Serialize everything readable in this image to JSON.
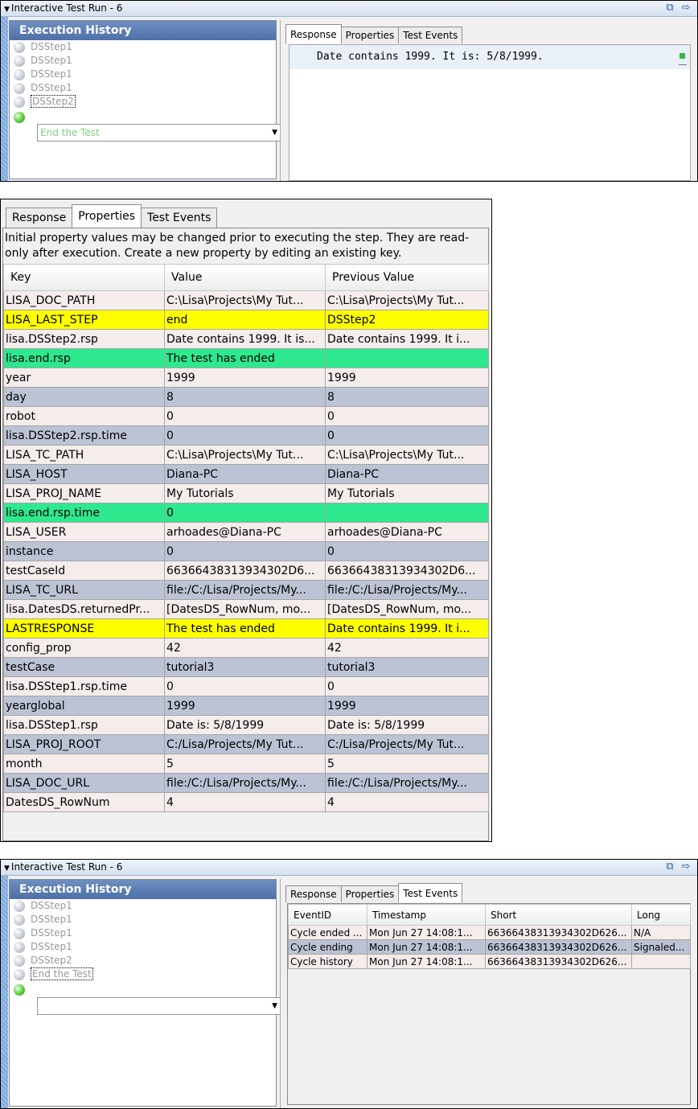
{
  "panel1": {
    "title": "Interactive Test Run - 6",
    "history_header": "Execution History",
    "steps": [
      "DSStep1",
      "DSStep1",
      "DSStep1",
      "DSStep1",
      "DSStep2"
    ],
    "combo_value": "End the Test",
    "tabs": [
      "Response",
      "Properties",
      "Test Events"
    ],
    "active_tab": "Response",
    "response_text": "Date contains 1999. It is: 5/8/1999."
  },
  "panel2": {
    "tabs": [
      "Response",
      "Properties",
      "Test Events"
    ],
    "active_tab": "Properties",
    "info": "Initial property values may be changed prior to executing the step. They are read-only after execution. Create a new property by editing an existing key.",
    "columns": [
      "Key",
      "Value",
      "Previous Value"
    ],
    "colors": {
      "pink": "#f5ecec",
      "blue": "#bbc3d4",
      "yellow": "#ffff00",
      "green": "#2ee88e"
    },
    "rows": [
      {
        "key": "LISA_DOC_PATH",
        "value": "C:\\Lisa\\Projects\\My Tut...",
        "prev": "C:\\Lisa\\Projects\\My Tut...",
        "hl": "pink"
      },
      {
        "key": "LISA_LAST_STEP",
        "value": "end",
        "prev": "DSStep2",
        "hl": "yellow"
      },
      {
        "key": "lisa.DSStep2.rsp",
        "value": "Date contains 1999. It is...",
        "prev": "Date contains 1999. It i...",
        "hl": "pink"
      },
      {
        "key": "lisa.end.rsp",
        "value": "The test has ended",
        "prev": "",
        "hl": "green"
      },
      {
        "key": "year",
        "value": "1999",
        "prev": "1999",
        "hl": "pink"
      },
      {
        "key": "day",
        "value": "8",
        "prev": "8",
        "hl": "blue"
      },
      {
        "key": "robot",
        "value": "0",
        "prev": "0",
        "hl": "pink"
      },
      {
        "key": "lisa.DSStep2.rsp.time",
        "value": "0",
        "prev": "0",
        "hl": "blue"
      },
      {
        "key": "LISA_TC_PATH",
        "value": "C:\\Lisa\\Projects\\My Tut...",
        "prev": "C:\\Lisa\\Projects\\My Tut...",
        "hl": "pink"
      },
      {
        "key": "LISA_HOST",
        "value": "Diana-PC",
        "prev": "Diana-PC",
        "hl": "blue"
      },
      {
        "key": "LISA_PROJ_NAME",
        "value": "My Tutorials",
        "prev": "My Tutorials",
        "hl": "pink"
      },
      {
        "key": "lisa.end.rsp.time",
        "value": "0",
        "prev": "",
        "hl": "green"
      },
      {
        "key": "LISA_USER",
        "value": "arhoades@Diana-PC",
        "prev": "arhoades@Diana-PC",
        "hl": "pink"
      },
      {
        "key": "instance",
        "value": "0",
        "prev": "0",
        "hl": "blue"
      },
      {
        "key": "testCaseId",
        "value": "66366438313934302D6...",
        "prev": "66366438313934302D6...",
        "hl": "pink"
      },
      {
        "key": "LISA_TC_URL",
        "value": "file:/C:/Lisa/Projects/My...",
        "prev": "file:/C:/Lisa/Projects/My...",
        "hl": "blue"
      },
      {
        "key": "lisa.DatesDS.returnedPr...",
        "value": "[DatesDS_RowNum, mo...",
        "prev": "[DatesDS_RowNum, mo...",
        "hl": "pink"
      },
      {
        "key": "LASTRESPONSE",
        "value": "The test has ended",
        "prev": "Date contains 1999. It i...",
        "hl": "yellow"
      },
      {
        "key": "config_prop",
        "value": "42",
        "prev": "42",
        "hl": "pink"
      },
      {
        "key": "testCase",
        "value": "tutorial3",
        "prev": "tutorial3",
        "hl": "blue"
      },
      {
        "key": "lisa.DSStep1.rsp.time",
        "value": "0",
        "prev": "0",
        "hl": "pink"
      },
      {
        "key": "yearglobal",
        "value": "1999",
        "prev": "1999",
        "hl": "blue"
      },
      {
        "key": "lisa.DSStep1.rsp",
        "value": "Date is: 5/8/1999",
        "prev": "Date is: 5/8/1999",
        "hl": "pink"
      },
      {
        "key": "LISA_PROJ_ROOT",
        "value": "C:/Lisa/Projects/My Tut...",
        "prev": "C:/Lisa/Projects/My Tut...",
        "hl": "blue"
      },
      {
        "key": "month",
        "value": "5",
        "prev": "5",
        "hl": "pink"
      },
      {
        "key": "LISA_DOC_URL",
        "value": "file:/C:/Lisa/Projects/My...",
        "prev": "file:/C:/Lisa/Projects/My...",
        "hl": "blue"
      },
      {
        "key": "DatesDS_RowNum",
        "value": "4",
        "prev": "4",
        "hl": "pink"
      }
    ]
  },
  "panel3": {
    "title": "Interactive Test Run - 6",
    "history_header": "Execution History",
    "steps": [
      "DSStep1",
      "DSStep1",
      "DSStep1",
      "DSStep1",
      "DSStep2",
      "End the Test"
    ],
    "combo_value": "",
    "tabs": [
      "Response",
      "Properties",
      "Test Events"
    ],
    "active_tab": "Test Events",
    "columns": [
      "EventID",
      "Timestamp",
      "Short",
      "Long"
    ],
    "events": [
      {
        "id": "Cycle ended ...",
        "ts": "Mon Jun 27 14:08:1...",
        "short": "66366438313934302D626...",
        "long": "N/A",
        "hl": "pink"
      },
      {
        "id": "Cycle ending",
        "ts": "Mon Jun 27 14:08:1...",
        "short": "66366438313934302D626...",
        "long": "Signaled...",
        "hl": "blue"
      },
      {
        "id": "Cycle history",
        "ts": "Mon Jun 27 14:08:1...",
        "short": "66366438313934302D626...",
        "long": "",
        "hl": "pink"
      }
    ]
  }
}
